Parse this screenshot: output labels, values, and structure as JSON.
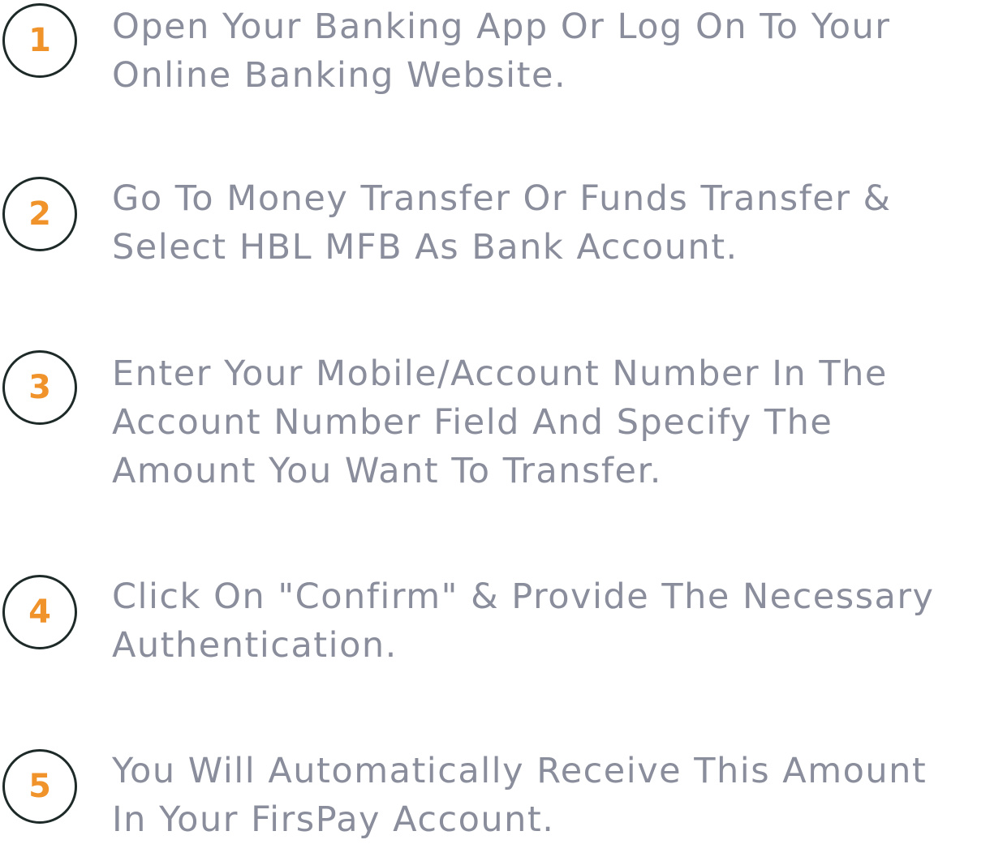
{
  "steps": [
    {
      "number": "1",
      "text": "Open Your Banking App Or Log On To Your\nOnline Banking Website."
    },
    {
      "number": "2",
      "text": "Go To Money Transfer Or Funds Transfer &\nSelect HBL MFB As Bank Account."
    },
    {
      "number": "3",
      "text": "Enter Your Mobile/Account Number In The\nAccount Number Field And Specify The\nAmount You Want To Transfer."
    },
    {
      "number": "4",
      "text": "Click On \"Confirm\" & Provide The Necessary\nAuthentication."
    },
    {
      "number": "5",
      "text": "You Will Automatically Receive This Amount\nIn Your FirsPay Account."
    }
  ],
  "colors": {
    "badge_number": "#f0932b",
    "badge_border": "#1d2a28",
    "text": "#8a8d9b",
    "background": "#ffffff"
  }
}
